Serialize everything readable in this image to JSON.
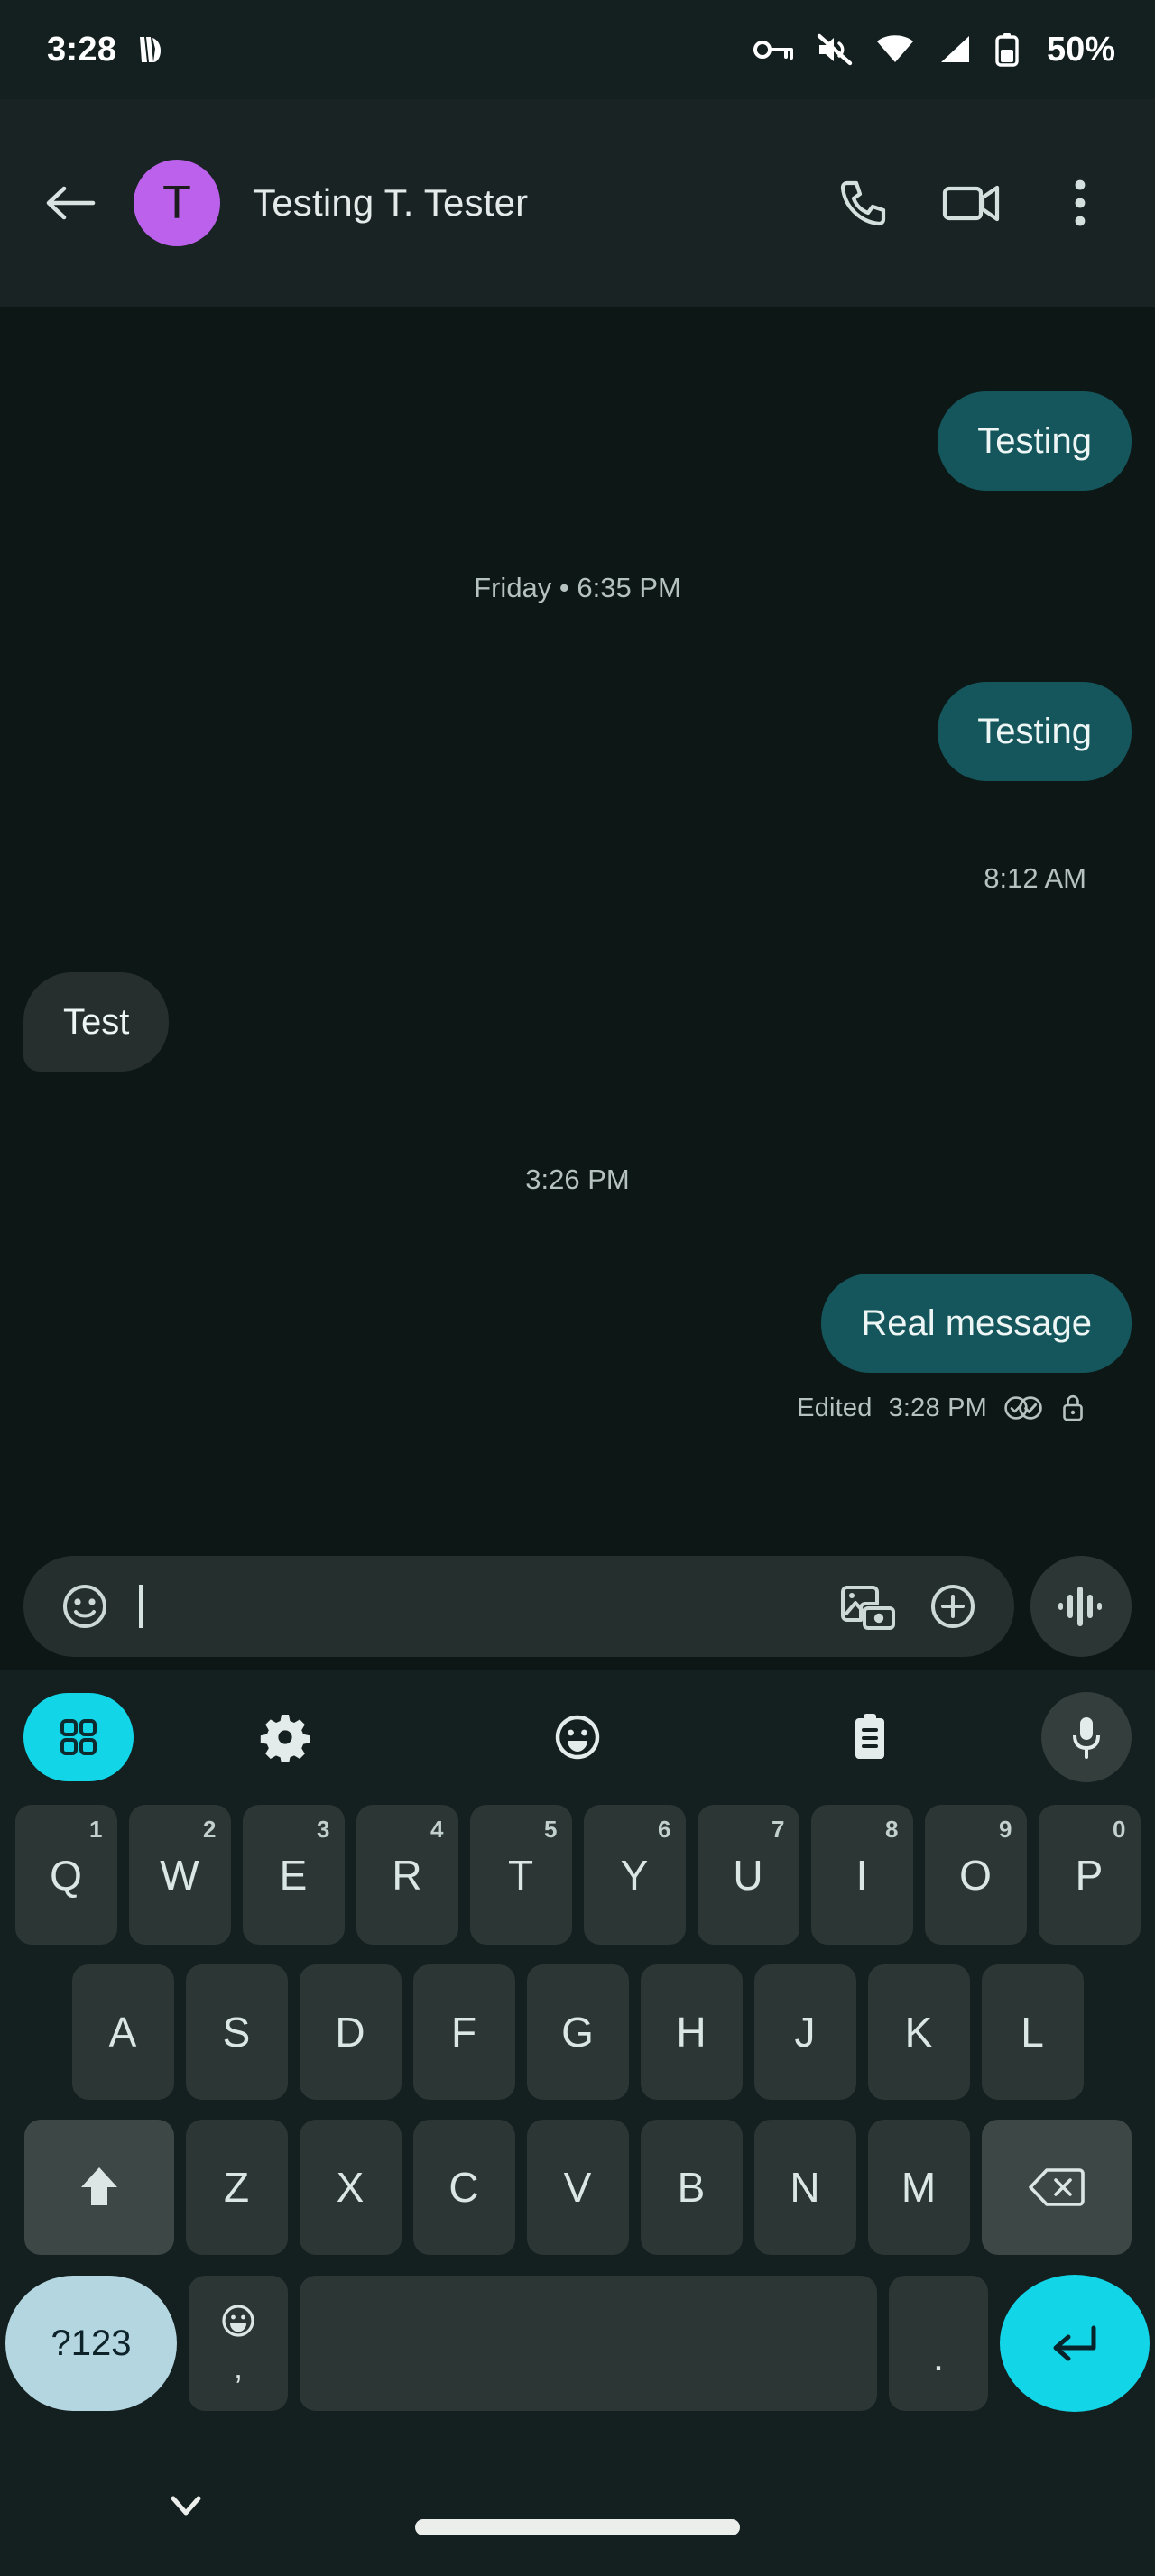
{
  "status_bar": {
    "clock": "3:28",
    "battery_percent": "50%",
    "icons": [
      "notification-app-icon",
      "vpn-key-icon",
      "volume-muted-icon",
      "wifi-icon",
      "cellular-signal-icon",
      "battery-icon"
    ]
  },
  "app_bar": {
    "back_label": "back-arrow",
    "avatar_initial": "T",
    "avatar_color": "#bb61ec",
    "title": "Testing T. Tester",
    "actions": [
      "phone-call-icon",
      "video-call-icon",
      "overflow-menu-icon"
    ]
  },
  "conversation": {
    "items": [
      {
        "kind": "bubble",
        "side": "out",
        "text": "Testing"
      },
      {
        "kind": "timestamp",
        "align": "center",
        "text": "Friday • 6:35 PM"
      },
      {
        "kind": "bubble",
        "side": "out",
        "text": "Testing"
      },
      {
        "kind": "timestamp",
        "align": "right",
        "text": "8:12 AM"
      },
      {
        "kind": "bubble",
        "side": "in",
        "text": "Test"
      },
      {
        "kind": "timestamp",
        "align": "center",
        "text": "3:26 PM"
      },
      {
        "kind": "bubble",
        "side": "out",
        "text": "Real message"
      }
    ],
    "last_message_meta": {
      "edited_label": "Edited",
      "time": "3:28 PM",
      "delivery_icon": "double-check-icon",
      "encryption_icon": "lock-icon"
    },
    "bubble_out_color": "#14565c",
    "bubble_in_color": "#262f2e"
  },
  "composer": {
    "emoji_icon": "emoji-smiley-icon",
    "value": "",
    "placeholder": "",
    "gallery_icon": "gallery-camera-icon",
    "plus_icon": "plus-circle-icon",
    "voice_icon": "voice-waveform-icon"
  },
  "keyboard": {
    "toolbar": [
      {
        "name": "toolbar-apps-button",
        "icon": "grid-apps-icon",
        "accent": "#12d6e8"
      },
      {
        "name": "toolbar-settings-button",
        "icon": "gear-icon"
      },
      {
        "name": "toolbar-emoji-button",
        "icon": "emoji-face-icon"
      },
      {
        "name": "toolbar-clipboard-button",
        "icon": "clipboard-icon"
      },
      {
        "name": "toolbar-mic-button",
        "icon": "microphone-icon"
      }
    ],
    "row1": [
      {
        "letter": "Q",
        "number": "1"
      },
      {
        "letter": "W",
        "number": "2"
      },
      {
        "letter": "E",
        "number": "3"
      },
      {
        "letter": "R",
        "number": "4"
      },
      {
        "letter": "T",
        "number": "5"
      },
      {
        "letter": "Y",
        "number": "6"
      },
      {
        "letter": "U",
        "number": "7"
      },
      {
        "letter": "I",
        "number": "8"
      },
      {
        "letter": "O",
        "number": "9"
      },
      {
        "letter": "P",
        "number": "0"
      }
    ],
    "row2": [
      "A",
      "S",
      "D",
      "F",
      "G",
      "H",
      "J",
      "K",
      "L"
    ],
    "row3": {
      "shift_icon": "shift-up-arrow-icon",
      "letters": [
        "Z",
        "X",
        "C",
        "V",
        "B",
        "N",
        "M"
      ],
      "backspace_icon": "backspace-delete-icon"
    },
    "row4": {
      "symbols_label": "?123",
      "emoji_icon": "emoji-face-icon",
      "comma": ",",
      "space_label": "",
      "period": ".",
      "enter_icon": "enter-return-icon",
      "enter_color": "#12d6e8",
      "symbols_color": "#b3d6e0"
    }
  },
  "navigation": {
    "dismiss_icon": "chevron-down-icon",
    "home_indicator": "home-gesture-bar"
  }
}
